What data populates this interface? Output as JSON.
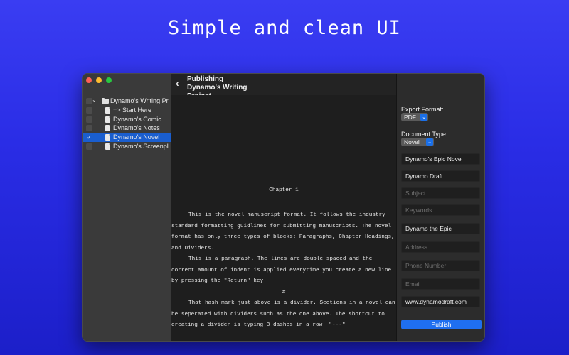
{
  "headline": "Simple and clean UI",
  "sidebar": {
    "project": "Dynamo's Writing Pr",
    "items": [
      {
        "label": "=> Start Here",
        "checked": false,
        "selected": false
      },
      {
        "label": "Dynamo's Comic",
        "checked": false,
        "selected": false
      },
      {
        "label": "Dynamo's Notes",
        "checked": false,
        "selected": false
      },
      {
        "label": "Dynamo's Novel",
        "checked": true,
        "selected": true
      },
      {
        "label": "Dynamo's Screenpl",
        "checked": false,
        "selected": false
      }
    ],
    "check_glyph": "✓"
  },
  "middle": {
    "title": "Publishing Dynamo's Writing Project",
    "manuscript": {
      "chapter": "Chapter 1",
      "para1": "This is the novel manuscript format. It follows the industry standard formatting guidlines for submitting manuscripts. The novel format has only three types of blocks: Paragraphs, Chapter Headings, and Dividers.",
      "para2": "This is a paragraph. The lines are double spaced and the correct amount of indent is applied everytime you create a new line by pressing the \"Return\" key.",
      "divider": "#",
      "para3": "That hash mark just above is a divider. Sections in a novel can be seperated with dividers such as the one above. The shortcut to creating a divider is typing 3 dashes in a row: \"---\""
    }
  },
  "export": {
    "format_label": "Export Format:",
    "format_value": "PDF",
    "doctype_label": "Document Type:",
    "doctype_value": "Novel",
    "popup_arrows": "⌄"
  },
  "fields": {
    "title": {
      "value": "Dynamo's Epic Novel",
      "placeholder": ""
    },
    "subtitle": {
      "value": "Dynamo Draft",
      "placeholder": ""
    },
    "subject": {
      "value": "",
      "placeholder": "Subject"
    },
    "keywords": {
      "value": "",
      "placeholder": "Keywords"
    },
    "author": {
      "value": "Dynamo the Epic",
      "placeholder": ""
    },
    "address": {
      "value": "",
      "placeholder": "Address"
    },
    "phone": {
      "value": "",
      "placeholder": "Phone Number"
    },
    "email": {
      "value": "",
      "placeholder": "Email"
    },
    "website": {
      "value": "www.dynamodraft.com",
      "placeholder": ""
    }
  },
  "publish_label": "Publish",
  "colors": {
    "background": "#2a2de6",
    "accent": "#1f6ff0",
    "selection": "#1a5ecf"
  }
}
